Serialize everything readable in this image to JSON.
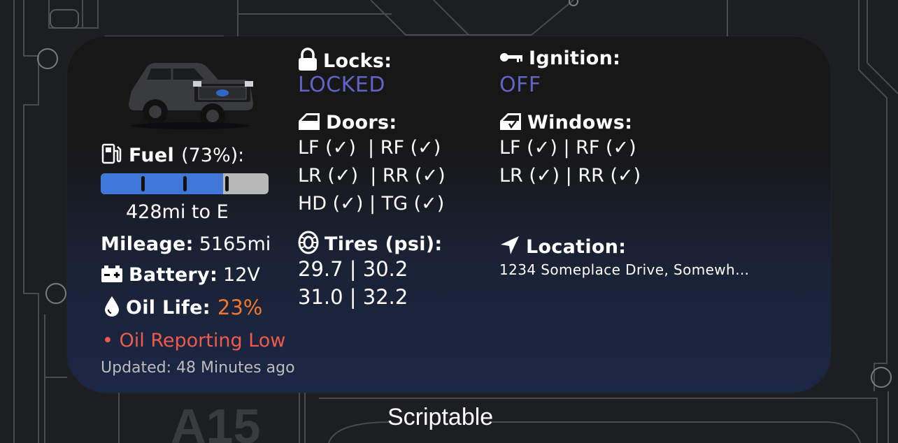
{
  "left": {
    "fuel_label": "Fuel",
    "fuel_percent": "(73%):",
    "fuel_level": 0.73,
    "range": "428mi to E",
    "mileage_label": "Mileage:",
    "mileage_value": "5165mi",
    "battery_label": "Battery:",
    "battery_value": "12V",
    "oil_label": "Oil Life:",
    "oil_value": "23%",
    "alert": "• Oil Reporting Low",
    "updated": "Updated: 48 Minutes ago"
  },
  "middle": {
    "locks_label": "Locks:",
    "locks_value": "LOCKED",
    "doors_label": "Doors:",
    "doors": [
      {
        "text": "LF (✓)  | RF (✓)"
      },
      {
        "text": "LR (✓)  | RR (✓)"
      },
      {
        "text": "HD (✓) | TG (✓)"
      }
    ],
    "tires_label": "Tires (psi):",
    "tires": [
      "29.7 | 30.2",
      "31.0 | 32.2"
    ]
  },
  "right": {
    "ignition_label": "Ignition:",
    "ignition_value": "OFF",
    "windows_label": "Windows:",
    "windows": [
      {
        "text": "LF (✓) | RF (✓)"
      },
      {
        "text": "LR (✓) | RR (✓)"
      }
    ],
    "location_label": "Location:",
    "location_value": "1234 Someplace Drive, Somewh…"
  },
  "dock": {
    "app_label": "Scriptable",
    "background_chip": "A15"
  },
  "colors": {
    "accent_blue": "#6462c6",
    "oil_orange": "#f0782c",
    "alert_red": "#ef5a4c",
    "fuel_blue": "#3f78d8"
  }
}
